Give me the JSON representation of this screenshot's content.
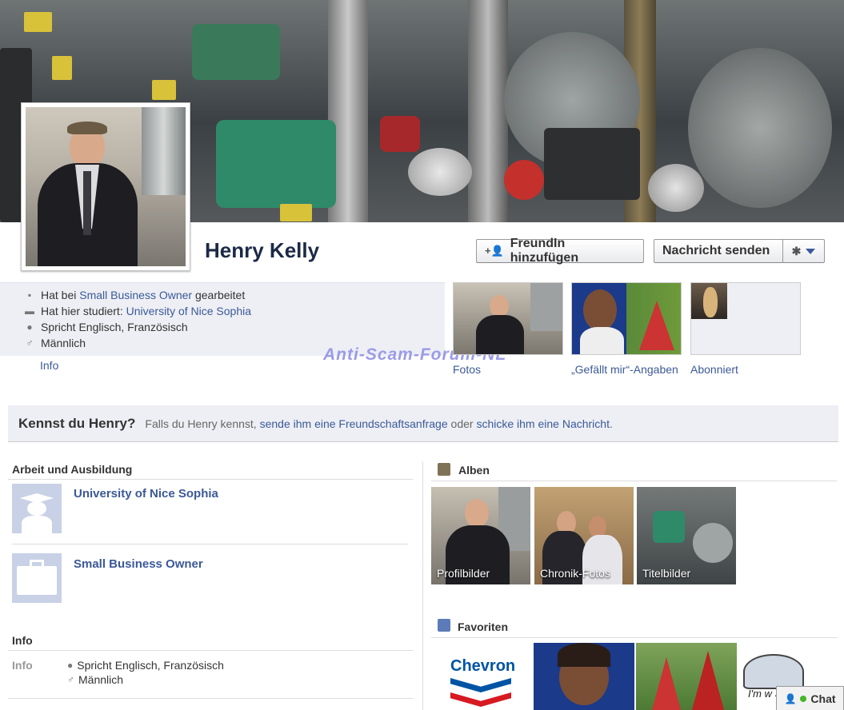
{
  "profile": {
    "name": "Henry Kelly",
    "add_friend_label": "FreundIn hinzufügen",
    "message_label": "Nachricht senden"
  },
  "about": {
    "work_prefix": "Hat bei",
    "work_link": "Small Business Owner",
    "work_suffix": "gearbeitet",
    "study_prefix": "Hat hier studiert:",
    "study_link": "University of Nice Sophia",
    "languages": "Spricht Englisch, Französisch",
    "gender": "Männlich",
    "info_link": "Info"
  },
  "watermark": "Anti-Scam-Forum-NL",
  "thumbs": {
    "photos": "Fotos",
    "likes": "„Gefällt mir“-Angaben",
    "subscribed": "Abonniert"
  },
  "kennst": {
    "heading": "Kennst du Henry?",
    "text1": "Falls du Henry kennst,",
    "link1": "sende ihm eine Freundschaftsanfrage",
    "text2": "oder",
    "link2": "schicke ihm eine Nachricht",
    "text3": "."
  },
  "work_edu": {
    "title": "Arbeit und Ausbildung",
    "items": [
      {
        "label": "University of Nice Sophia"
      },
      {
        "label": "Small Business Owner"
      }
    ]
  },
  "info_section": {
    "title": "Info",
    "row_label": "Info",
    "languages": "Spricht Englisch, Französisch",
    "gender": "Männlich"
  },
  "albums": {
    "title": "Alben",
    "items": [
      {
        "label": "Profilbilder"
      },
      {
        "label": "Chronik-Fotos"
      },
      {
        "label": "Titelbilder"
      }
    ]
  },
  "favorites": {
    "title": "Favoriten",
    "chevron": "Chevron",
    "globe_text": "I'm w Stud"
  },
  "chat": {
    "label": "Chat"
  },
  "colors": {
    "link": "#3b5998",
    "name": "#1c2a47",
    "panel": "#edeff4"
  }
}
